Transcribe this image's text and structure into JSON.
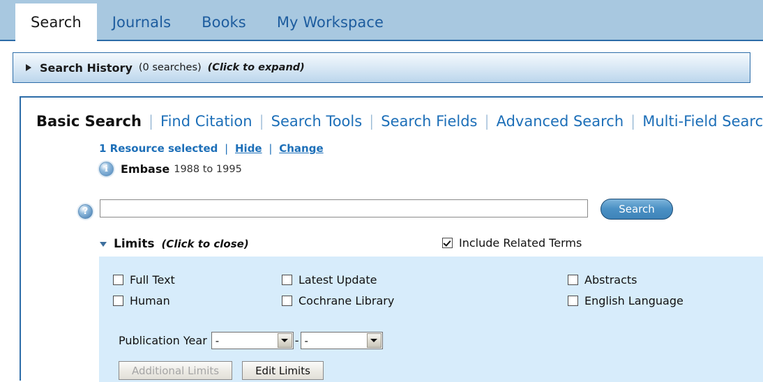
{
  "top_nav": {
    "tabs": [
      {
        "label": "Search",
        "active": true
      },
      {
        "label": "Journals",
        "active": false
      },
      {
        "label": "Books",
        "active": false
      },
      {
        "label": "My Workspace",
        "active": false
      }
    ]
  },
  "search_history": {
    "title": "Search History",
    "count": "(0 searches)",
    "hint": "(Click to expand)",
    "arrow_icon": "triangle-right-icon"
  },
  "subtabs": [
    {
      "label": "Basic Search",
      "active": true
    },
    {
      "label": "Find Citation",
      "active": false
    },
    {
      "label": "Search Tools",
      "active": false
    },
    {
      "label": "Search Fields",
      "active": false
    },
    {
      "label": "Advanced Search",
      "active": false
    },
    {
      "label": "Multi-Field Search",
      "active": false
    }
  ],
  "separator": "|",
  "resource": {
    "selected_text": "1 Resource selected",
    "hide_label": "Hide",
    "change_label": "Change",
    "database_name": "Embase",
    "database_range": "1988 to 1995",
    "info_icon": "info-icon",
    "info_glyph": "i"
  },
  "search": {
    "help_icon": "help-question-icon",
    "help_glyph": "?",
    "input_value": "",
    "input_placeholder": "",
    "button_label": "Search"
  },
  "limits": {
    "header_title": "Limits",
    "header_hint": "(Click to close)",
    "toggle_icon": "triangle-down-icon",
    "include_related_terms": {
      "label": "Include Related Terms",
      "checked": true
    },
    "checkboxes": [
      {
        "label": "Full Text",
        "checked": false,
        "column": 1
      },
      {
        "label": "Latest Update",
        "checked": false,
        "column": 2
      },
      {
        "label": "Abstracts",
        "checked": false,
        "column": 3
      },
      {
        "label": "Human",
        "checked": false,
        "column": 1
      },
      {
        "label": "Cochrane Library",
        "checked": false,
        "column": 2
      },
      {
        "label": "English Language",
        "checked": false,
        "column": 3
      }
    ],
    "publication_year": {
      "label": "Publication Year",
      "from_value": "-",
      "to_value": "-",
      "separator": "-",
      "dropdown_icon": "chevron-down-icon"
    },
    "buttons": [
      {
        "label": "Additional Limits",
        "disabled": true
      },
      {
        "label": "Edit Limits",
        "disabled": false
      }
    ]
  },
  "colors": {
    "top_bar_blue": "#a8c8e0",
    "border_blue": "#2c6ca8",
    "link_blue": "#1d6fb8",
    "limits_panel_blue": "#d7ecfb",
    "search_button_blue": "#4a90c4"
  }
}
